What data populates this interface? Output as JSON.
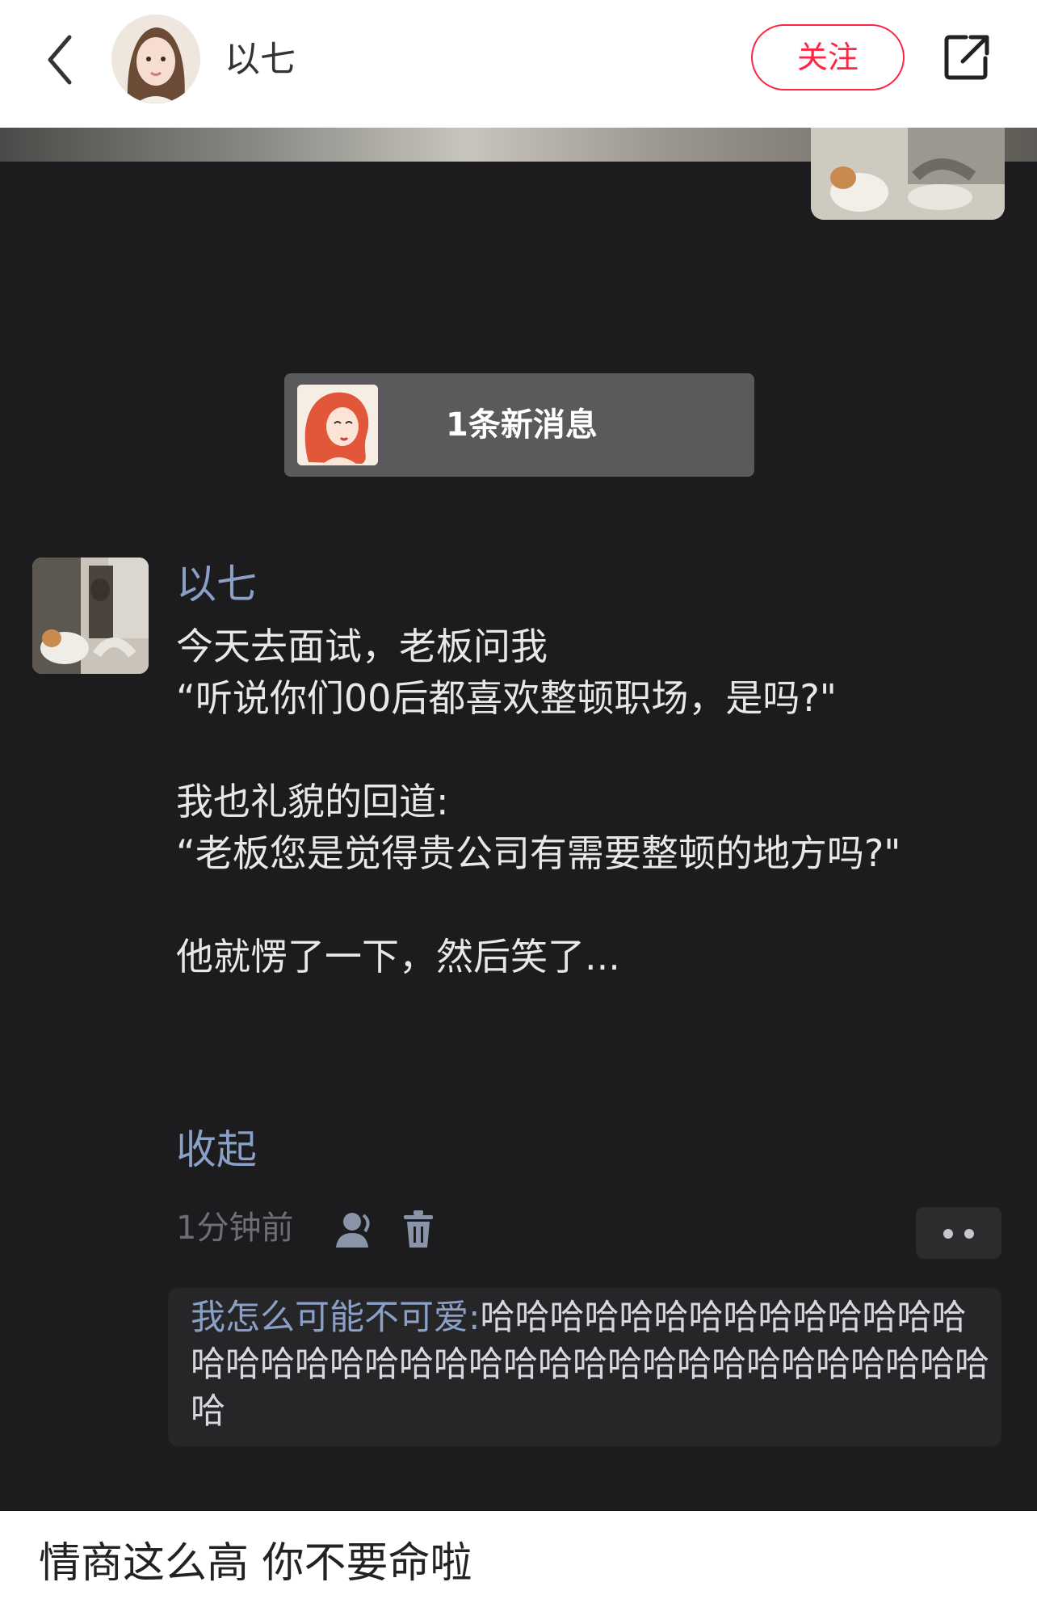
{
  "header": {
    "author_name": "以七",
    "follow_label": "关注"
  },
  "screenshot": {
    "new_message_label": "1条新消息",
    "message": {
      "sender": "以七",
      "body": "今天去面试，老板问我\n“听说你们00后都喜欢整顿职场，是吗?\"\n\n我也礼貌的回道:\n“老板您是觉得贵公司有需要整顿的地方吗?\"\n\n他就愣了一下，然后笑了...",
      "collapse_label": "收起",
      "time": "1分钟前"
    },
    "reply": {
      "name": "我怎么可能不可爱:",
      "text": "哈哈哈哈哈哈哈哈哈哈哈哈哈哈哈哈哈哈哈哈哈哈哈哈哈哈哈哈哈哈哈哈哈哈哈哈哈哈"
    }
  },
  "caption": "情商这么高 你不要命啦",
  "colors": {
    "brand_red": "#ff2442",
    "link_blue": "#8aa0c6",
    "dark_bg": "#1c1c1e"
  },
  "icons": [
    "back-chevron-icon",
    "share-icon",
    "person-icon",
    "trash-icon",
    "more-dots-icon"
  ]
}
